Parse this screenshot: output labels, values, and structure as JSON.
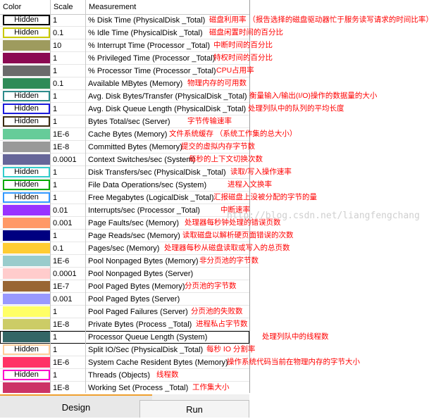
{
  "header": {
    "color": "Color",
    "scale": "Scale",
    "measurement": "Measurement"
  },
  "rows": [
    {
      "color": "#ffffff",
      "hidden": true,
      "border": "#000000",
      "label": "Hidden",
      "scale": "1",
      "measurement": "% Disk Time (PhysicalDisk _Total)",
      "note": "磁盘利用率  （报告选择的磁盘驱动器忙于服务读写请求的时间比率）"
    },
    {
      "color": "#ffffff",
      "hidden": true,
      "border": "#c8c800",
      "label": "Hidden",
      "scale": "0.1",
      "measurement": "% Idle Time (PhysicalDisk _Total)",
      "note": "磁盘闲置时间的百分比"
    },
    {
      "color": "#9e9b5e",
      "hidden": false,
      "scale": "10",
      "measurement": "% Interrupt Time (Processor _Total)",
      "note": "中断时间的百分比"
    },
    {
      "color": "#8b0a52",
      "hidden": false,
      "scale": "1",
      "measurement": "% Privileged Time (Processor _Total)",
      "note": "特权时间的百分比"
    },
    {
      "color": "#6b6b6b",
      "hidden": false,
      "scale": "1",
      "measurement": "% Processor Time (Processor _Total)",
      "note": "CPU占用率"
    },
    {
      "color": "#2e8b57",
      "hidden": false,
      "scale": "0.1",
      "measurement": "Available MBytes (Memory)",
      "note": "物理内存的可用数"
    },
    {
      "color": "#ffffff",
      "hidden": true,
      "border": "#2e8b8b",
      "label": "Hidden",
      "scale": "1",
      "measurement": "Avg. Disk Bytes/Transfer (PhysicalDisk _Total)",
      "note": "衡量输入/输出(I/O)操作的数据量的大小"
    },
    {
      "color": "#ffffff",
      "hidden": true,
      "border": "#1a1adb",
      "label": "Hidden",
      "scale": "1",
      "measurement": "Avg. Disk Queue Length (PhysicalDisk _Total)",
      "note": "处理列队中的队列的平均长度"
    },
    {
      "color": "#ffffff",
      "hidden": true,
      "border": "#3a2a10",
      "label": "Hidden",
      "scale": "1",
      "measurement": "Bytes Total/sec (Server)",
      "note": "字节传输速率"
    },
    {
      "color": "#66cc99",
      "hidden": false,
      "scale": "1E-6",
      "measurement": "Cache Bytes (Memory)",
      "note": "文件系统缓存  （系统工作集的总大小）"
    },
    {
      "color": "#999999",
      "hidden": false,
      "scale": "1E-8",
      "measurement": "Committed Bytes (Memory)",
      "note": "提交的虚拟内存字节数"
    },
    {
      "color": "#666699",
      "hidden": false,
      "scale": "0.0001",
      "measurement": "Context Switches/sec (System)",
      "note": "每秒的上下文切换次数"
    },
    {
      "color": "#ffffff",
      "hidden": true,
      "border": "#33cccc",
      "label": "Hidden",
      "scale": "1",
      "measurement": "Disk Transfers/sec (PhysicalDisk _Total)",
      "note": "读取/写入操作速率"
    },
    {
      "color": "#ffffff",
      "hidden": true,
      "border": "#00aa00",
      "label": "Hidden",
      "scale": "1",
      "measurement": "File Data Operations/sec (System)",
      "note": "进程入文换率"
    },
    {
      "color": "#ffffff",
      "hidden": true,
      "border": "#3399ff",
      "label": "Hidden",
      "scale": "1",
      "measurement": "Free Megabytes (LogicalDisk _Total)",
      "note": "汇报磁盘上没被分配的字节的量"
    },
    {
      "color": "#9933ff",
      "hidden": false,
      "scale": "0.01",
      "measurement": "Interrupts/sec (Processor _Total)",
      "note": "中断速率"
    },
    {
      "color": "#ff9966",
      "hidden": false,
      "scale": "0.001",
      "measurement": "Page Faults/sec (Memory)",
      "note": "处理器每秒钟处理的错误页数"
    },
    {
      "color": "#000080",
      "hidden": false,
      "scale": "1",
      "measurement": "Page Reads/sec (Memory)",
      "note": "读取磁盘以解析硬页面错误的次数"
    },
    {
      "color": "#ffcc33",
      "hidden": false,
      "scale": "0.1",
      "measurement": "Pages/sec (Memory)",
      "note": "处理器每秒从磁盘读取或写入的总页数"
    },
    {
      "color": "#99cccc",
      "hidden": false,
      "scale": "1E-6",
      "measurement": "Pool Nonpaged Bytes (Memory)",
      "note": "非分页池的字节数"
    },
    {
      "color": "#ffcccc",
      "hidden": false,
      "scale": "0.0001",
      "measurement": "Pool Nonpaged Bytes (Server)",
      "note": ""
    },
    {
      "color": "#996633",
      "hidden": false,
      "scale": "1E-7",
      "measurement": "Pool Paged Bytes (Memory)",
      "note": "分页池的字节数"
    },
    {
      "color": "#9999ff",
      "hidden": false,
      "scale": "0.001",
      "measurement": "Pool Paged Bytes (Server)",
      "note": ""
    },
    {
      "color": "#ffff66",
      "hidden": false,
      "scale": "1",
      "measurement": "Pool Paged Failures (Server)",
      "note": "分页池的失败数"
    },
    {
      "color": "#cccc66",
      "hidden": false,
      "scale": "1E-8",
      "measurement": "Private Bytes (Process _Total)",
      "note": "进程私占字节数"
    },
    {
      "color": "#336666",
      "hidden": false,
      "scale": "1",
      "measurement": "Processor Queue Length (System)",
      "note": "处理列队中的线程数",
      "selected": true
    },
    {
      "color": "#ffffff",
      "hidden": true,
      "border": "#ffcc99",
      "label": "Hidden",
      "scale": "1",
      "measurement": "Split IO/Sec (PhysicalDisk _Total)",
      "note": "每秒 IO 分割率"
    },
    {
      "color": "#ff3366",
      "hidden": false,
      "scale": "1E-6",
      "measurement": "System Cache Resident Bytes (Memory)",
      "note": "操作系统代码当前在物理内存的字节大小"
    },
    {
      "color": "#ffffff",
      "hidden": true,
      "border": "#ff00cc",
      "label": "Hidden",
      "scale": "1",
      "measurement": "Threads (Objects)",
      "note": "线程数"
    },
    {
      "color": "#cc3366",
      "hidden": false,
      "scale": "1E-8",
      "measurement": "Working Set (Process _Total)",
      "note": "工作集大小"
    }
  ],
  "watermark": "http://blog.csdn.net/liangfengchang",
  "tabs": {
    "design": "Design",
    "run": "Run"
  }
}
